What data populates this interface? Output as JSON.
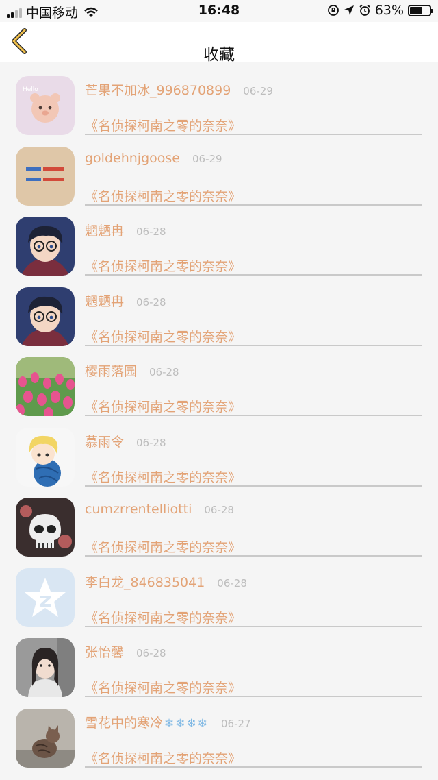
{
  "status_bar": {
    "carrier": "中国移动",
    "time": "16:48",
    "battery": "63%"
  },
  "nav": {
    "title": "收藏",
    "back_icon": "chevron-left-icon"
  },
  "colors": {
    "accent": "#e3a376",
    "date": "#bdbdbd",
    "separator": "#c9c9c9"
  },
  "favorites": [
    {
      "name": "芒果不加冰_996870899",
      "date": "06-29",
      "title": "《名侦探柯南之零的奈奈》",
      "avatar": "bear-avatar"
    },
    {
      "name": "goldehnjgoose",
      "date": "06-29",
      "title": "《名侦探柯南之零的奈奈》",
      "avatar": "text-card-avatar"
    },
    {
      "name": "魍魉冉",
      "date": "06-28",
      "title": "《名侦探柯南之零的奈奈》",
      "avatar": "conan-avatar"
    },
    {
      "name": "魍魉冉",
      "date": "06-28",
      "title": "《名侦探柯南之零的奈奈》",
      "avatar": "conan-avatar"
    },
    {
      "name": "樱雨落园",
      "date": "06-28",
      "title": "《名侦探柯南之零的奈奈》",
      "avatar": "tulips-avatar"
    },
    {
      "name": "慕雨令",
      "date": "06-28",
      "title": "《名侦探柯南之零的奈奈》",
      "avatar": "anime-boy-avatar"
    },
    {
      "name": "cumzrrentelliotti",
      "date": "06-28",
      "title": "《名侦探柯南之零的奈奈》",
      "avatar": "skull-avatar"
    },
    {
      "name": "李白龙_846835041",
      "date": "06-28",
      "title": "《名侦探柯南之零的奈奈》",
      "avatar": "qzone-star-avatar"
    },
    {
      "name": "张怡馨",
      "date": "06-28",
      "title": "《名侦探柯南之零的奈奈》",
      "avatar": "girl-photo-avatar"
    },
    {
      "name": "雪花中的寒冷",
      "name_suffix": "❄❄❄❄",
      "date": "06-27",
      "title": "《名侦探柯南之零的奈奈》",
      "avatar": "cat-photo-avatar"
    }
  ]
}
